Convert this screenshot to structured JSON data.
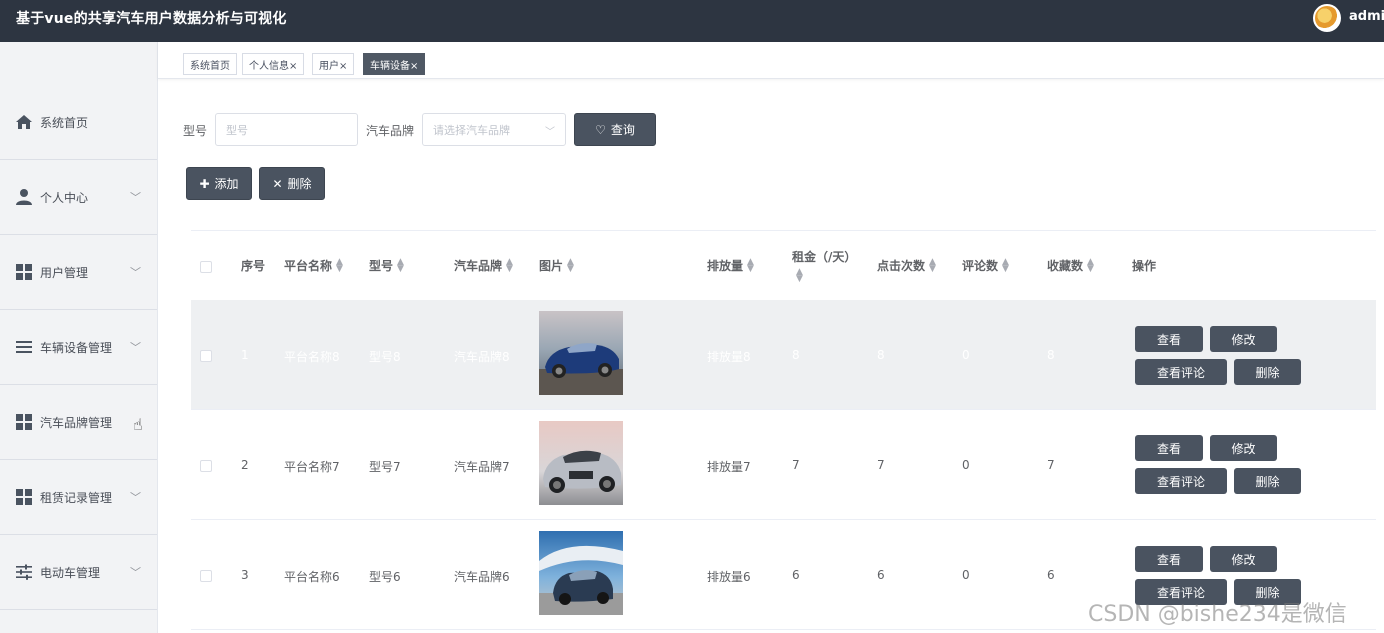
{
  "header": {
    "title": "基于vue的共享汽车用户数据分析与可视化",
    "user": "admin"
  },
  "sidebar": {
    "items": [
      {
        "label": "系统首页",
        "icon": "home-icon"
      },
      {
        "label": "个人中心",
        "icon": "user-icon"
      },
      {
        "label": "用户管理",
        "icon": "grid-icon"
      },
      {
        "label": "车辆设备管理",
        "icon": "list-icon"
      },
      {
        "label": "汽车品牌管理",
        "icon": "grid-icon"
      },
      {
        "label": "租赁记录管理",
        "icon": "grid-icon"
      },
      {
        "label": "电动车管理",
        "icon": "sliders-icon"
      }
    ]
  },
  "tabs": [
    {
      "label": "系统首页"
    },
    {
      "label": "个人信息×"
    },
    {
      "label": "用户×"
    },
    {
      "label": "车辆设备×"
    }
  ],
  "search": {
    "model_label": "型号",
    "model_placeholder": "型号",
    "brand_label": "汽车品牌",
    "brand_placeholder": "请选择汽车品牌",
    "query_button": "查询"
  },
  "actions": {
    "add": "添加",
    "delete": "删除"
  },
  "table": {
    "columns": [
      "序号",
      "平台名称",
      "型号",
      "汽车品牌",
      "图片",
      "排放量",
      "租金（/天）",
      "点击次数",
      "评论数",
      "收藏数",
      "操作"
    ],
    "rows": [
      {
        "index": "1",
        "platform": "平台名称8",
        "model": "型号8",
        "brand": "汽车品牌8",
        "emission": "排放量8",
        "rent": "8",
        "clicks": "8",
        "comments": "0",
        "favorites": "8"
      },
      {
        "index": "2",
        "platform": "平台名称7",
        "model": "型号7",
        "brand": "汽车品牌7",
        "emission": "排放量7",
        "rent": "7",
        "clicks": "7",
        "comments": "0",
        "favorites": "7"
      },
      {
        "index": "3",
        "platform": "平台名称6",
        "model": "型号6",
        "brand": "汽车品牌6",
        "emission": "排放量6",
        "rent": "6",
        "clicks": "6",
        "comments": "0",
        "favorites": "6"
      }
    ],
    "row_actions": {
      "view": "查看",
      "edit": "修改",
      "view_comments": "查看评论",
      "delete": "删除"
    }
  },
  "watermark": "CSDN @bishe234是微信"
}
